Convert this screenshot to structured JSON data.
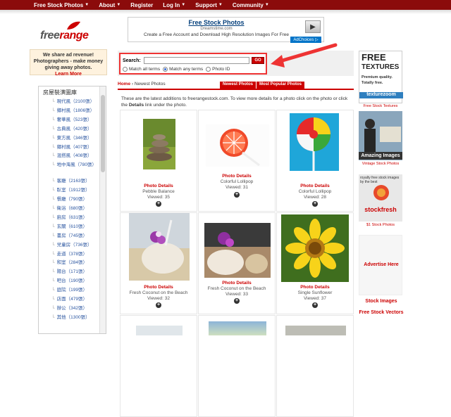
{
  "nav": {
    "items": [
      {
        "label": "Free Stock Photos",
        "dropdown": true
      },
      {
        "label": "About",
        "dropdown": true
      },
      {
        "label": "Register",
        "dropdown": false
      },
      {
        "label": "Log In",
        "dropdown": true
      },
      {
        "label": "Support",
        "dropdown": true
      },
      {
        "label": "Community",
        "dropdown": true
      }
    ]
  },
  "logo": {
    "text_a": "free",
    "text_b": "range"
  },
  "top_ad": {
    "title": "Free Stock Photos",
    "site": "Dreamstime.com",
    "tagline": "Create a Free Account and Download High Resolution Images For Free",
    "adchoices": "AdChoices ▷"
  },
  "promo": {
    "line1": "We share ad revenue!",
    "line2": "Photographers - make money",
    "line3": "giving away photos.",
    "link": "Learn More"
  },
  "search": {
    "label": "Search:",
    "value": "",
    "go": "GO",
    "options": [
      {
        "label": "Match all terms",
        "selected": false
      },
      {
        "label": "Match any terms",
        "selected": true
      },
      {
        "label": "Photo ID",
        "selected": false
      }
    ]
  },
  "breadcrumb": {
    "home": "Home",
    "separator": "›",
    "current": "Newest Photos",
    "tabs": [
      "Newest Photos",
      "Most Popular Photos"
    ]
  },
  "intro": {
    "text1": "These are the latest additions to freerangestock.com. To view more details for a photo click on the photo or click the ",
    "bold": "Details",
    "text2": " link under the photo."
  },
  "photos": [
    {
      "details": "Photo Details",
      "title": "Pebble Balance",
      "views": "Viewed: 35"
    },
    {
      "details": "Photo Details",
      "title": "Colorful Lollipop",
      "views": "Viewed: 31"
    },
    {
      "details": "Photo Details",
      "title": "Colorful Lollipop",
      "views": "Viewed: 28"
    },
    {
      "details": "Photo Details",
      "title": "Fresh Coconut on the Beach",
      "views": "Viewed: 32"
    },
    {
      "details": "Photo Details",
      "title": "Fresh Coconut on the Beach",
      "views": "Viewed: 33"
    },
    {
      "details": "Photo Details",
      "title": "Single Sunflower",
      "views": "Viewed: 37"
    }
  ],
  "sidebar": {
    "header": "房屋裝潢圖庫",
    "group1": [
      "現代風（2100張）",
      "鄉村風（1806張）",
      "奢華風（523張）",
      "古典風（420張）",
      "東方風（346張）",
      "鄉村風（407張）",
      "混搭風（408張）",
      "地中海風（780張）"
    ],
    "group2": [
      "客廳（2163張）",
      "臥室（1912張）",
      "餐廳（790張）",
      "衛浴（680張）",
      "廚房（631張）",
      "玄關（610張）",
      "書房（745張）",
      "兒童房（736張）",
      "走道（378張）",
      "和室（284張）",
      "陽台（171張）",
      "吧台（190張）",
      "庭院（199張）",
      "店面（479張）",
      "辦公（342張）",
      "其他（1300張）"
    ]
  },
  "right": {
    "textures_t1": "FREE",
    "textures_t1b": "TEXTURES",
    "textures_t2": "Premium quality.",
    "textures_t3": "Totally free.",
    "textures_brand": "texturezoom",
    "textures_link": "Free Stock Textures",
    "vintage_label": "Amazing Images",
    "vintage_link": "Vintage Stock Photos",
    "stockfresh_tag": "royalty free stock images by the best",
    "stockfresh_brand": "stockfresh",
    "stockfresh_link": "$1 Stock Photos",
    "advertise": "Advertise Here",
    "link1": "Stock Images",
    "link2": "Free Stock Vectors"
  }
}
